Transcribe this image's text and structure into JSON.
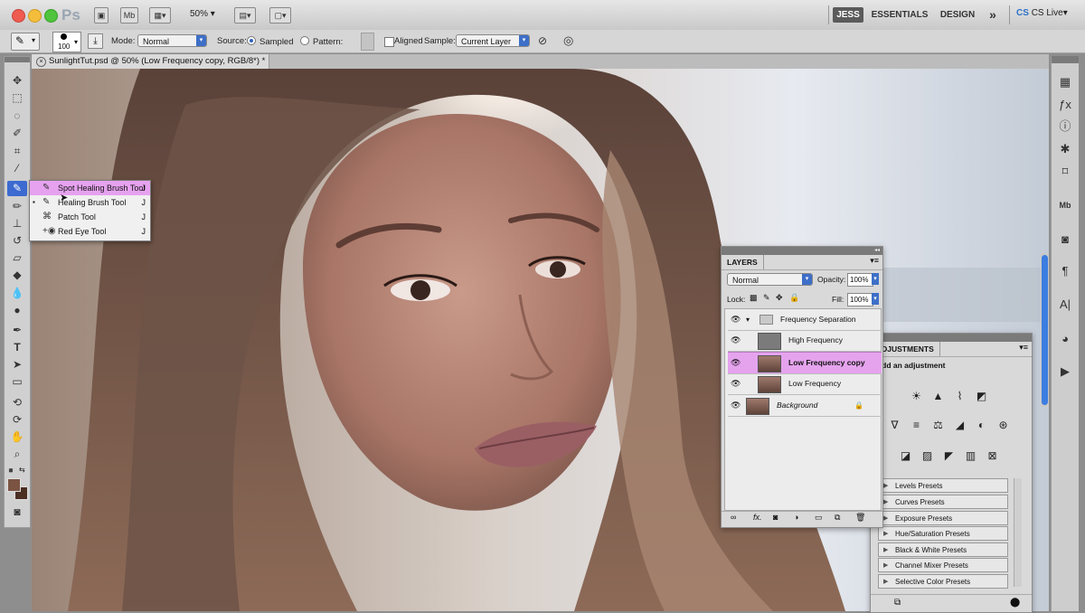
{
  "app": {
    "logo": "Ps",
    "zoom": "50%",
    "workspaces": [
      "JESS",
      "ESSENTIALS",
      "DESIGN"
    ],
    "more": "»",
    "cslive": "CS Live",
    "minibridge": "Mb",
    "accent": "#3d6fc8"
  },
  "options": {
    "brush_size": "100",
    "mode_label": "Mode:",
    "mode_value": "Normal",
    "source_label": "Source:",
    "sampled": "Sampled",
    "pattern": "Pattern:",
    "aligned": "Aligned",
    "sample_label": "Sample:",
    "sample_value": "Current Layer"
  },
  "document": {
    "tab_title": "SunlightTut.psd @ 50% (Low Frequency copy, RGB/8*) *"
  },
  "flyout": {
    "items": [
      {
        "label": "Spot Healing Brush Tool",
        "key": "J",
        "icon": "spot-healing-icon"
      },
      {
        "label": "Healing Brush Tool",
        "key": "J",
        "icon": "healing-brush-icon"
      },
      {
        "label": "Patch Tool",
        "key": "J",
        "icon": "patch-icon"
      },
      {
        "label": "Red Eye Tool",
        "key": "J",
        "icon": "red-eye-icon"
      }
    ]
  },
  "layers": {
    "tab": "LAYERS",
    "blend_mode": "Normal",
    "opacity_label": "Opacity:",
    "opacity": "100%",
    "lock_label": "Lock:",
    "fill_label": "Fill:",
    "fill": "100%",
    "rows": [
      {
        "name": "Frequency Separation",
        "type": "group"
      },
      {
        "name": "High Frequency",
        "type": "layer"
      },
      {
        "name": "Low Frequency copy",
        "type": "layer",
        "selected": true
      },
      {
        "name": "Low Frequency",
        "type": "layer"
      },
      {
        "name": "Background",
        "type": "background"
      }
    ],
    "selected_color": "#e5a3ee"
  },
  "adjustments": {
    "tab": "ADJUSTMENTS",
    "header": "Add an adjustment",
    "presets": [
      "Levels Presets",
      "Curves Presets",
      "Exposure Presets",
      "Hue/Saturation Presets",
      "Black & White Presets",
      "Channel Mixer Presets",
      "Selective Color Presets"
    ]
  }
}
